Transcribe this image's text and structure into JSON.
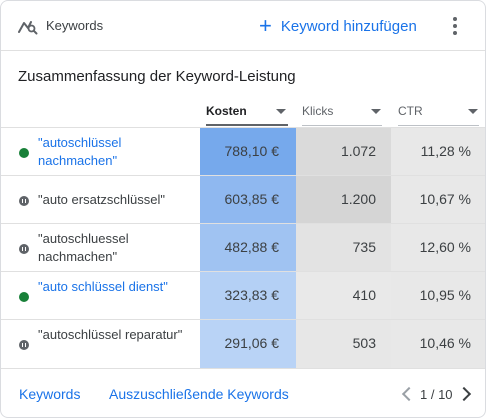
{
  "header": {
    "title": "Keywords",
    "icon": "keyword-search-icon",
    "add_label": "Keyword hinzufügen",
    "more_icon": "more-vert-icon"
  },
  "subtitle": "Zusammenfassung der Keyword-Leistung",
  "columns": [
    {
      "label": "Kosten",
      "sorted": true
    },
    {
      "label": "Klicks",
      "sorted": false
    },
    {
      "label": "CTR",
      "sorted": false
    }
  ],
  "rows": [
    {
      "keyword": "\"autoschlüssel nachmachen\"",
      "status": "enabled",
      "kosten": "788,10 €",
      "klicks": "1.072",
      "ctr": "11,28 %",
      "cost_color": "#76a9ec",
      "clicks_color": "#dadada"
    },
    {
      "keyword": "\"auto ersatzschlüssel\"",
      "status": "paused",
      "kosten": "603,85 €",
      "klicks": "1.200",
      "ctr": "10,67 %",
      "cost_color": "#8fb8f0",
      "clicks_color": "#d5d5d5"
    },
    {
      "keyword": "\"autoschluessel nachmachen\"",
      "status": "paused",
      "kosten": "482,88 €",
      "klicks": "735",
      "ctr": "12,60 %",
      "cost_color": "#a0c3f2",
      "clicks_color": "#e3e3e3"
    },
    {
      "keyword": "\"auto schlüssel dienst\"",
      "status": "enabled",
      "kosten": "323,83 €",
      "klicks": "410",
      "ctr": "10,95 %",
      "cost_color": "#b4d0f5",
      "clicks_color": "#e9e9e9"
    },
    {
      "keyword": "\"autoschlüssel reparatur\"",
      "status": "paused",
      "kosten": "291,06 €",
      "klicks": "503",
      "ctr": "10,46 %",
      "cost_color": "#b9d3f6",
      "clicks_color": "#e7e7e7"
    }
  ],
  "footer": {
    "link1": "Keywords",
    "link2": "Auszuschließende Keywords",
    "pagination": "1 / 10"
  },
  "colors": {
    "accent": "#1a73e8",
    "enabled_dot": "#188038",
    "paused_dot": "#5f6368",
    "ctr_bg": "#e8e8e8"
  }
}
